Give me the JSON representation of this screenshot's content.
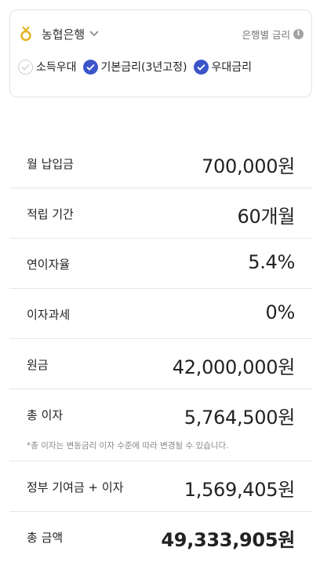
{
  "bank": {
    "name": "농협은행",
    "rate_link": "은행별 금리",
    "info_glyph": "i",
    "logo_icon": "nonghyup-logo-icon",
    "options": [
      {
        "label": "소득우대",
        "checked": false
      },
      {
        "label": "기본금리(3년고정)",
        "checked": true
      },
      {
        "label": "우대금리",
        "checked": true
      }
    ]
  },
  "rows": [
    {
      "label": "월 납입금",
      "value": "700,000원"
    },
    {
      "label": "적립 기간",
      "value": "60개월"
    },
    {
      "label": "연이자율",
      "value": "5.4%"
    },
    {
      "label": "이자과세",
      "value": "0%"
    },
    {
      "label": "원금",
      "value": "42,000,000원"
    },
    {
      "label": "총 이자",
      "value": "5,764,500원",
      "note": "*총 이자는 변동금리 이자 수준에 따라 변경될 수 있습니다."
    },
    {
      "label": "정부 기여금 + 이자",
      "value": "1,569,405원"
    },
    {
      "label": "총 금액",
      "value": "49,333,905원"
    }
  ],
  "colors": {
    "accent": "#3b55c9",
    "logo_gold": "#e6b31e",
    "divider": "#e6e6e6"
  }
}
